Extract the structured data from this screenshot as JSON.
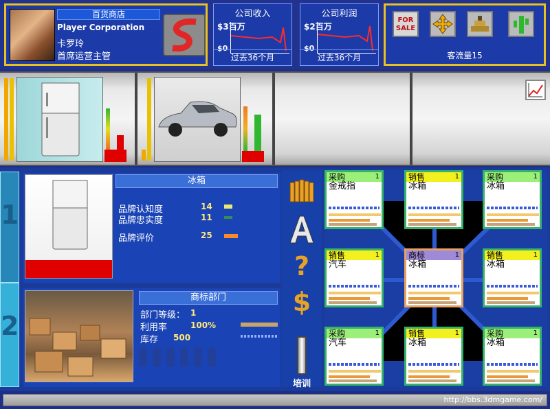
{
  "player": {
    "store_name": "百货商店",
    "corporation": "Player Corporation",
    "name": "卡罗玲",
    "title": "首席运营主管"
  },
  "finance": [
    {
      "title": "公司收入",
      "max_label": "$3百万",
      "zero_label": "$0",
      "period": "过去36个月"
    },
    {
      "title": "公司利润",
      "max_label": "$2百万",
      "zero_label": "$0",
      "period": "过去36个月"
    }
  ],
  "actions": {
    "sale_label": "FOR SALE",
    "traffic": "客流量15"
  },
  "shelf": {
    "products": [
      {
        "name": "refrigerator",
        "bars": [
          0.85,
          0.3,
          0.25
        ]
      },
      {
        "name": "car",
        "bars": [
          0.75,
          0.62,
          0.19
        ]
      }
    ]
  },
  "detail": {
    "tab1": "1",
    "tab2": "2",
    "product_title": "冰箱",
    "stats": [
      {
        "label": "品牌认知度",
        "value": "14",
        "color": "#e8e676"
      },
      {
        "label": "品牌忠实度",
        "value": "11",
        "color": "#3a8a5a"
      },
      {
        "label": "品牌评价",
        "value": "25",
        "color": "#ff8a2a"
      }
    ]
  },
  "dept": {
    "title": "商标部门",
    "level_label": "部门等级：",
    "level": "1",
    "util_label": "利用率",
    "util": "100%",
    "stock_label": "库存",
    "stock": "500"
  },
  "tools": {
    "train_label": "培训"
  },
  "cards": [
    {
      "type": "采购",
      "num": "1",
      "item": "金戒指",
      "head": "#9cf07a"
    },
    {
      "type": "销售",
      "num": "1",
      "item": "冰箱",
      "head": "#f3f01f"
    },
    {
      "type": "采购",
      "num": "1",
      "item": "冰箱",
      "head": "#9cf07a"
    },
    {
      "type": "销售",
      "num": "1",
      "item": "汽车",
      "head": "#f3f01f"
    },
    {
      "type": "商标",
      "num": "1",
      "item": "冰箱",
      "head": "#9f8ad8"
    },
    {
      "type": "销售",
      "num": "1",
      "item": "冰箱",
      "head": "#f3f01f"
    },
    {
      "type": "采购",
      "num": "1",
      "item": "汽车",
      "head": "#9cf07a"
    },
    {
      "type": "销售",
      "num": "1",
      "item": "冰箱",
      "head": "#f3f01f"
    },
    {
      "type": "采购",
      "num": "1",
      "item": "冰箱",
      "head": "#9cf07a"
    }
  ],
  "status": {
    "watermark": "http://bbs.3dmgame.com/"
  }
}
